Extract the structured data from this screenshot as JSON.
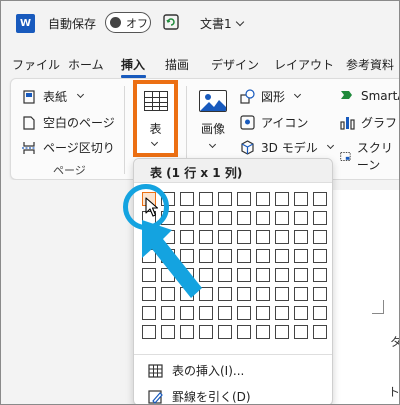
{
  "titlebar": {
    "app_logo": "W",
    "autosave_label": "自動保存",
    "autosave_state": "オフ",
    "document_title": "文書1"
  },
  "tabs": [
    "ファイル",
    "ホーム",
    "挿入",
    "描画",
    "デザイン",
    "レイアウト",
    "参考資料"
  ],
  "active_tab": "挿入",
  "ribbon": {
    "pages_group": {
      "items": [
        "表紙",
        "空白のページ",
        "ページ区切り"
      ],
      "label": "ページ"
    },
    "table_button": "表",
    "image_button": "画像",
    "illustrations": [
      "図形",
      "アイコン",
      "3D モデル"
    ],
    "more": [
      "SmartArt",
      "グラフ",
      "スクリーン"
    ]
  },
  "table_dropdown": {
    "header": "表 (1 行 x 1 列)",
    "grid_rows": 8,
    "grid_cols": 10,
    "selected_rows": 1,
    "selected_cols": 1,
    "menu_items": [
      "表の挿入(I)...",
      "罫線を引く(D)"
    ]
  },
  "document": {
    "visible_chars": [
      "タ",
      "ト"
    ]
  },
  "colors": {
    "accent": "#185abd",
    "highlight_box": "#ec6f13",
    "annotation": "#14a3e0",
    "selected_cell": "#fce4cf"
  }
}
